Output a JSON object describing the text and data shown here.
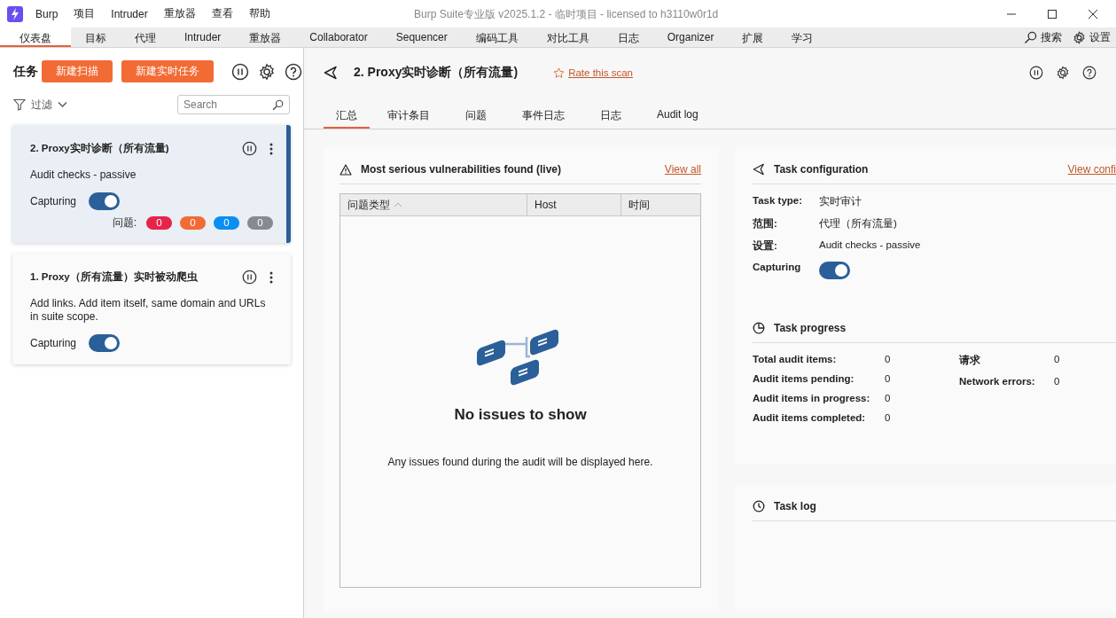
{
  "window": {
    "title": "Burp Suite专业版  v2025.1.2 - 临时项目 - licensed to h3110w0r1d"
  },
  "menu": [
    "Burp",
    "项目",
    "Intruder",
    "重放器",
    "查看",
    "帮助"
  ],
  "tabs": [
    {
      "label": "仪表盘",
      "selected": true
    },
    {
      "label": "目标",
      "selected": false
    },
    {
      "label": "代理",
      "selected": false
    },
    {
      "label": "Intruder",
      "selected": false
    },
    {
      "label": "重放器",
      "selected": false
    },
    {
      "label": "Collaborator",
      "selected": false
    },
    {
      "label": "Sequencer",
      "selected": false
    },
    {
      "label": "编码工具",
      "selected": false
    },
    {
      "label": "对比工具",
      "selected": false
    },
    {
      "label": "日志",
      "selected": false
    },
    {
      "label": "Organizer",
      "selected": false
    },
    {
      "label": "扩展",
      "selected": false
    },
    {
      "label": "学习",
      "selected": false
    }
  ],
  "toolbar_actions": {
    "search": "搜索",
    "settings": "设置"
  },
  "tasks_panel": {
    "title": "任务",
    "buttons": [
      "新建扫描",
      "新建实时任务"
    ],
    "filter": "过滤",
    "search": {
      "placeholder": "Search"
    },
    "tasks": [
      {
        "title": "2. Proxy实时诊断（所有流量)",
        "description": "Audit checks - passive",
        "capturing_label": "Capturing",
        "capturing": true,
        "selected": true,
        "issues_label": "问题:",
        "issue_counts": [
          {
            "count": "0",
            "color": "#e8234a"
          },
          {
            "count": "0",
            "color": "#f26b35"
          },
          {
            "count": "0",
            "color": "#0a8ff0"
          },
          {
            "count": "0",
            "color": "#878b90"
          }
        ]
      },
      {
        "title": "1. Proxy（所有流量）实时被动爬虫",
        "description": "Add links. Add item itself, same domain and URLs in suite scope.",
        "capturing_label": "Capturing",
        "capturing": true,
        "selected": false
      }
    ]
  },
  "detail": {
    "title": "2. Proxy实时诊断（所有流量)",
    "rate_link": "Rate this scan",
    "tabs": [
      {
        "label": "汇总",
        "selected": true
      },
      {
        "label": "审计条目",
        "selected": false
      },
      {
        "label": "问题",
        "selected": false
      },
      {
        "label": "事件日志",
        "selected": false
      },
      {
        "label": "日志",
        "selected": false
      },
      {
        "label": "Audit log",
        "selected": false
      }
    ],
    "vulnerabilities": {
      "title": "Most serious vulnerabilities found (live)",
      "view_all": "View all",
      "columns": [
        "问题类型",
        "Host",
        "时间"
      ],
      "empty_title": "No issues to show",
      "empty_text": "Any issues found during the audit will be displayed here."
    },
    "task_configuration": {
      "title": "Task configuration",
      "view_link": "View confi",
      "fields": [
        {
          "label": "Task type:",
          "value": "实时审计"
        },
        {
          "label": "范围:",
          "value": "代理（所有流量)"
        },
        {
          "label": "设置:",
          "value": "Audit checks - passive"
        }
      ],
      "capturing_label": "Capturing",
      "capturing": true
    },
    "task_progress": {
      "title": "Task progress",
      "columns": [
        [
          {
            "label": "Total audit items:",
            "value": "0"
          },
          {
            "label": "Audit items pending:",
            "value": "0"
          },
          {
            "label": "Audit items in progress:",
            "value": "0"
          },
          {
            "label": "Audit items completed:",
            "value": "0"
          }
        ],
        [
          {
            "label": "请求",
            "value": "0"
          },
          {
            "label": "Network errors:",
            "value": "0"
          }
        ]
      ]
    },
    "task_log": {
      "title": "Task log"
    }
  }
}
